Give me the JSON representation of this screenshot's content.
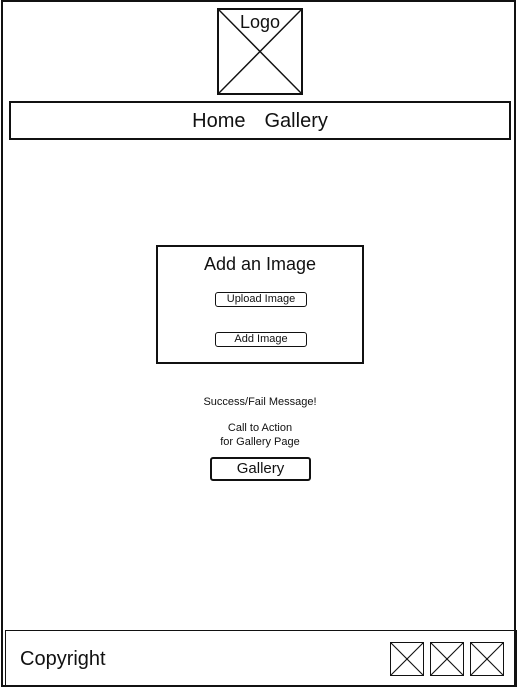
{
  "header": {
    "logo_text": "Logo"
  },
  "nav": {
    "items": [
      {
        "label": "Home"
      },
      {
        "label": "Gallery"
      }
    ]
  },
  "upload_panel": {
    "title": "Add an Image",
    "upload_button": "Upload Image",
    "add_button": "Add Image"
  },
  "messages": {
    "status": "Success/Fail Message!",
    "cta_line1": "Call to Action",
    "cta_line2": "for Gallery Page",
    "gallery_button": "Gallery"
  },
  "footer": {
    "copyright": "Copyright",
    "icons": [
      "image-placeholder-icon",
      "image-placeholder-icon",
      "image-placeholder-icon"
    ]
  },
  "colors": {
    "stroke": "#111111",
    "background": "#ffffff"
  }
}
